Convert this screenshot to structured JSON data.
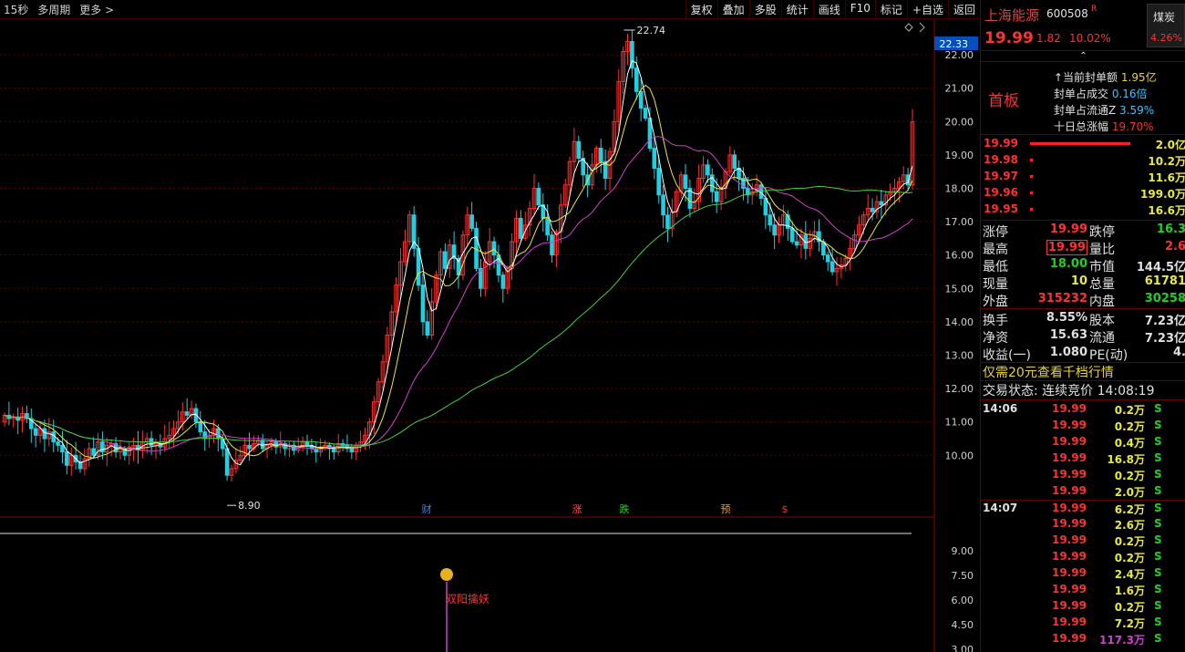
{
  "toolbar": {
    "period": "15秒",
    "multi_period": "多周期",
    "more": "更多 >",
    "buttons": [
      "复权",
      "叠加",
      "多股",
      "统计",
      "画线",
      "F10",
      "标记",
      "+自选",
      "返回"
    ]
  },
  "chart_data": {
    "type": "candlestick",
    "price_axis": {
      "ticks": [
        "22.00",
        "21.00",
        "20.00",
        "19.00",
        "18.00",
        "17.00",
        "16.00",
        "15.00",
        "14.00",
        "13.00",
        "12.00",
        "11.00",
        "10.00"
      ],
      "ylim": [
        8.5,
        22.5
      ],
      "current_label": "22.33"
    },
    "high_label": "22.74",
    "low_label": "8.90",
    "event_markers": [
      "财",
      "涨",
      "跌",
      "预",
      "$"
    ],
    "indicator_axis": {
      "ticks": [
        "9.00",
        "7.50",
        "6.00",
        "4.50",
        "3.00"
      ]
    },
    "indicator_marker": "双阳擒妖",
    "colors": {
      "up": "#ff3030",
      "down": "#20d0e0",
      "ma_fast": "#ffffff",
      "ma_mid": "#e8e840",
      "ma_slow": "#d040d0",
      "ma_long": "#40d040"
    },
    "close": [
      11.2,
      11.1,
      11.15,
      11.05,
      11.25,
      11.1,
      10.8,
      10.6,
      10.8,
      10.5,
      10.7,
      10.4,
      10.3,
      10.1,
      9.7,
      10.0,
      9.8,
      9.6,
      9.9,
      10.2,
      10.0,
      10.4,
      10.1,
      10.3,
      10.35,
      10.1,
      10.2,
      10.0,
      10.25,
      10.3,
      10.15,
      10.4,
      10.5,
      10.3,
      10.35,
      10.25,
      10.5,
      10.6,
      10.8,
      11.0,
      11.3,
      11.2,
      11.4,
      11.0,
      10.7,
      10.5,
      10.6,
      10.8,
      10.5,
      10.2,
      9.4,
      9.6,
      9.85,
      10.0,
      10.3,
      10.2,
      10.35,
      10.45,
      10.2,
      10.3,
      10.4,
      10.25,
      10.35,
      10.2,
      10.3,
      10.15,
      10.25,
      10.4,
      10.3,
      10.2,
      10.1,
      10.25,
      10.3,
      10.2,
      10.1,
      10.35,
      10.3,
      10.2,
      10.1,
      10.3,
      10.4,
      10.6,
      11.0,
      11.6,
      12.2,
      12.8,
      13.6,
      14.3,
      15.1,
      15.8,
      16.4,
      17.2,
      16.2,
      15.1,
      14.0,
      13.6,
      14.6,
      15.4,
      16.1,
      15.6,
      16.3,
      15.9,
      15.4,
      16.6,
      17.2,
      16.8,
      15.6,
      15.0,
      15.8,
      16.4,
      16.0,
      15.4,
      15.0,
      15.6,
      16.4,
      17.1,
      16.5,
      16.9,
      17.4,
      18.0,
      17.5,
      17.1,
      16.6,
      16.0,
      16.7,
      17.5,
      18.1,
      18.8,
      19.4,
      18.9,
      18.4,
      18.1,
      18.7,
      19.2,
      18.8,
      18.3,
      19.1,
      20.0,
      21.2,
      22.1,
      22.4,
      21.6,
      20.9,
      20.4,
      20.1,
      19.2,
      18.6,
      17.8,
      17.2,
      16.8,
      17.3,
      17.9,
      18.4,
      18.0,
      17.4,
      17.6,
      18.3,
      18.7,
      18.4,
      17.9,
      17.6,
      18.0,
      18.5,
      19.0,
      18.6,
      18.3,
      18.0,
      17.8,
      17.9,
      18.1,
      17.7,
      17.2,
      16.9,
      16.6,
      16.9,
      17.2,
      16.8,
      16.4,
      16.3,
      16.6,
      16.2,
      16.5,
      16.7,
      16.4,
      16.0,
      15.8,
      15.5,
      15.6,
      15.7,
      15.9,
      16.2,
      16.6,
      16.9,
      17.2,
      17.4,
      17.3,
      17.6,
      17.5,
      17.8,
      17.9,
      18.0,
      18.2,
      18.4,
      18.1,
      19.99
    ],
    "open": [
      11.0,
      11.2,
      11.1,
      11.15,
      11.05,
      11.25,
      11.1,
      10.8,
      10.6,
      10.8,
      10.5,
      10.7,
      10.4,
      10.3,
      10.1,
      9.7,
      10.0,
      9.8,
      9.6,
      9.9,
      10.2,
      10.0,
      10.4,
      10.1,
      10.3,
      10.35,
      10.1,
      10.2,
      10.0,
      10.25,
      10.3,
      10.15,
      10.4,
      10.5,
      10.3,
      10.35,
      10.25,
      10.5,
      10.6,
      10.8,
      11.0,
      11.3,
      11.2,
      11.4,
      11.0,
      10.7,
      10.5,
      10.6,
      10.8,
      10.5,
      10.2,
      9.4,
      9.6,
      9.85,
      10.0,
      10.3,
      10.2,
      10.35,
      10.45,
      10.2,
      10.3,
      10.4,
      10.25,
      10.35,
      10.2,
      10.3,
      10.15,
      10.25,
      10.4,
      10.3,
      10.2,
      10.1,
      10.25,
      10.3,
      10.2,
      10.1,
      10.35,
      10.3,
      10.2,
      10.1,
      10.3,
      10.4,
      10.6,
      11.0,
      11.6,
      12.2,
      12.8,
      13.6,
      14.3,
      15.1,
      15.8,
      16.4,
      17.2,
      16.2,
      15.1,
      14.0,
      13.6,
      14.6,
      15.4,
      16.1,
      15.6,
      16.3,
      15.9,
      15.4,
      16.6,
      17.2,
      16.8,
      15.6,
      15.0,
      15.8,
      16.4,
      16.0,
      15.4,
      15.0,
      15.6,
      16.4,
      17.1,
      16.5,
      16.9,
      17.4,
      18.0,
      17.5,
      17.1,
      16.6,
      16.0,
      16.7,
      17.5,
      18.1,
      18.8,
      19.4,
      18.9,
      18.4,
      18.1,
      18.7,
      19.2,
      18.8,
      18.3,
      19.1,
      20.0,
      21.2,
      22.1,
      22.4,
      21.6,
      20.9,
      20.4,
      20.1,
      19.2,
      18.6,
      17.8,
      17.2,
      16.8,
      17.3,
      17.9,
      18.4,
      18.0,
      17.4,
      17.6,
      18.3,
      18.7,
      18.4,
      17.9,
      17.6,
      18.0,
      18.5,
      19.0,
      18.6,
      18.3,
      18.0,
      17.8,
      17.9,
      18.1,
      17.7,
      17.2,
      16.9,
      16.6,
      16.9,
      17.2,
      16.8,
      16.4,
      16.3,
      16.6,
      16.2,
      16.5,
      16.7,
      16.4,
      16.0,
      15.8,
      15.5,
      15.6,
      15.7,
      15.9,
      16.2,
      16.6,
      16.9,
      17.2,
      17.4,
      17.3,
      17.6,
      17.5,
      17.8,
      17.9,
      18.0,
      18.2,
      18.4,
      18.1
    ]
  },
  "quote": {
    "name": "上海能源",
    "code": "600508",
    "rz": "R",
    "price": "19.99",
    "change": "1.82",
    "pct": "10.02%",
    "sector_name": "煤炭",
    "sector_pct": "4.26%",
    "board_tag": "首板",
    "seal": [
      {
        "k": "↑当前封单额",
        "v": "1.95亿",
        "color": "#e8d040"
      },
      {
        "k": "封单占成交",
        "v": "0.16倍",
        "color": "#40c0ff"
      },
      {
        "k": "封单占流通Z",
        "v": "3.59%",
        "color": "#40c0ff"
      },
      {
        "k": "十日总涨幅",
        "v": "19.70%",
        "color": "#ff3030"
      }
    ],
    "orders": [
      {
        "p": "19.99",
        "v": "2.0亿",
        "bar": 1
      },
      {
        "p": "19.98",
        "v": "10.2万",
        "bar": 0
      },
      {
        "p": "19.97",
        "v": "11.6万",
        "bar": 0
      },
      {
        "p": "19.96",
        "v": "199.0万",
        "bar": 0
      },
      {
        "p": "19.95",
        "v": "16.6万",
        "bar": 0
      }
    ],
    "stats": [
      {
        "l1": "涨停",
        "v1": "19.99",
        "c1": "#ff3030",
        "l2": "跌停",
        "v2": "16.3",
        "c2": "#20d020"
      },
      {
        "l1": "最高",
        "v1": "19.99",
        "c1": "#ff3030",
        "l2": "量比",
        "v2": "2.6",
        "c2": "#ff3030"
      },
      {
        "l1": "最低",
        "v1": "18.00",
        "c1": "#20d020",
        "l2": "市值",
        "v2": "144.5亿",
        "c2": "#e0e0e0"
      },
      {
        "l1": "现量",
        "v1": "10",
        "c1": "#e8e840",
        "l2": "总量",
        "v2": "61781",
        "c2": "#e8e840"
      },
      {
        "l1": "外盘",
        "v1": "315232",
        "c1": "#ff3030",
        "l2": "内盘",
        "v2": "30258",
        "c2": "#20d020"
      },
      {
        "l1": "换手",
        "v1": "8.55%",
        "c1": "#e0e0e0",
        "l2": "股本",
        "v2": "7.23亿",
        "c2": "#e0e0e0"
      },
      {
        "l1": "净资",
        "v1": "15.63",
        "c1": "#e0e0e0",
        "l2": "流通",
        "v2": "7.23亿",
        "c2": "#e0e0e0"
      },
      {
        "l1": "收益(一)",
        "v1": "1.080",
        "c1": "#e0e0e0",
        "l2": "PE(动)",
        "v2": "4.",
        "c2": "#e0e0e0"
      }
    ],
    "promo": "仅需20元查看千档行情",
    "status": "交易状态: 连续竞价 14:08:19",
    "ticks": [
      {
        "t": "14:06",
        "p": "19.99",
        "v": "0.2万",
        "s": "S"
      },
      {
        "t": "",
        "p": "19.99",
        "v": "0.2万",
        "s": "S"
      },
      {
        "t": "",
        "p": "19.99",
        "v": "0.4万",
        "s": "S"
      },
      {
        "t": "",
        "p": "19.99",
        "v": "16.8万",
        "s": "S"
      },
      {
        "t": "",
        "p": "19.99",
        "v": "0.2万",
        "s": "S"
      },
      {
        "t": "",
        "p": "19.99",
        "v": "2.0万",
        "s": "S"
      },
      {
        "t": "14:07",
        "p": "19.99",
        "v": "6.2万",
        "s": "S"
      },
      {
        "t": "",
        "p": "19.99",
        "v": "2.6万",
        "s": "S"
      },
      {
        "t": "",
        "p": "19.99",
        "v": "0.2万",
        "s": "S"
      },
      {
        "t": "",
        "p": "19.99",
        "v": "0.2万",
        "s": "S"
      },
      {
        "t": "",
        "p": "19.99",
        "v": "2.4万",
        "s": "S"
      },
      {
        "t": "",
        "p": "19.99",
        "v": "1.6万",
        "s": "S"
      },
      {
        "t": "",
        "p": "19.99",
        "v": "0.2万",
        "s": "S"
      },
      {
        "t": "",
        "p": "19.99",
        "v": "7.2万",
        "s": "S"
      },
      {
        "t": "",
        "p": "19.99",
        "v": "117.3万",
        "s": "S"
      }
    ]
  }
}
